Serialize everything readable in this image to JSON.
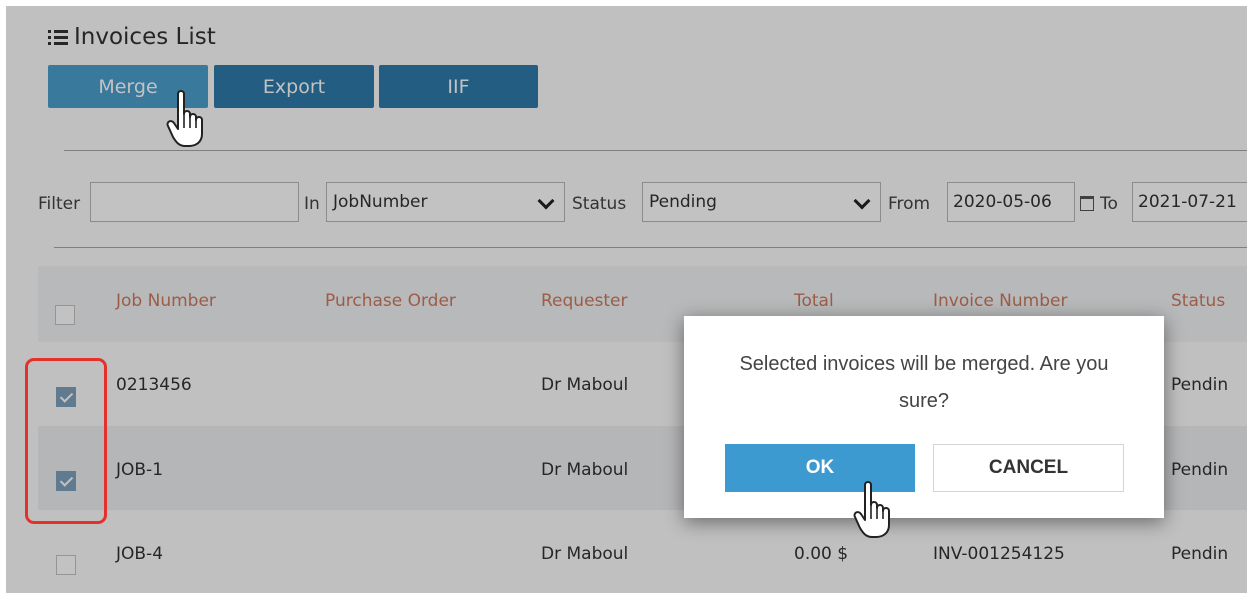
{
  "page": {
    "title": "Invoices List",
    "title_icon": "list-icon"
  },
  "toolbar": {
    "merge_label": "Merge",
    "export_label": "Export",
    "iif_label": "IIF"
  },
  "filters": {
    "filter_label": "Filter",
    "filter_value": "",
    "in_label": "In",
    "in_value": "JobNumber",
    "status_label": "Status",
    "status_value": "Pending",
    "from_label": "From",
    "from_value": "2020-05-06",
    "to_label": "To",
    "to_value": "2021-07-21"
  },
  "table": {
    "columns": [
      "Job Number",
      "Purchase Order",
      "Requester",
      "Total",
      "Invoice Number",
      "Status"
    ],
    "rows": [
      {
        "checked": true,
        "job_number": "0213456",
        "purchase_order": "",
        "requester": "Dr Maboul",
        "total": "",
        "invoice_number": "",
        "status": "Pendin"
      },
      {
        "checked": true,
        "job_number": "JOB-1",
        "purchase_order": "",
        "requester": "Dr Maboul",
        "total": "",
        "invoice_number": "",
        "status": "Pendin"
      },
      {
        "checked": false,
        "job_number": "JOB-4",
        "purchase_order": "",
        "requester": "Dr Maboul",
        "total": "0.00 $",
        "invoice_number": "INV-001254125",
        "status": "Pendin"
      }
    ]
  },
  "dialog": {
    "message_line1": "Selected invoices will be merged. Are you",
    "message_line2": "sure?",
    "ok_label": "OK",
    "cancel_label": "CANCEL"
  },
  "colors": {
    "primary_button": "#2f7bab",
    "header_text": "#cf7a5e",
    "ok_button": "#3d9ad1",
    "highlight": "#e4322b"
  }
}
